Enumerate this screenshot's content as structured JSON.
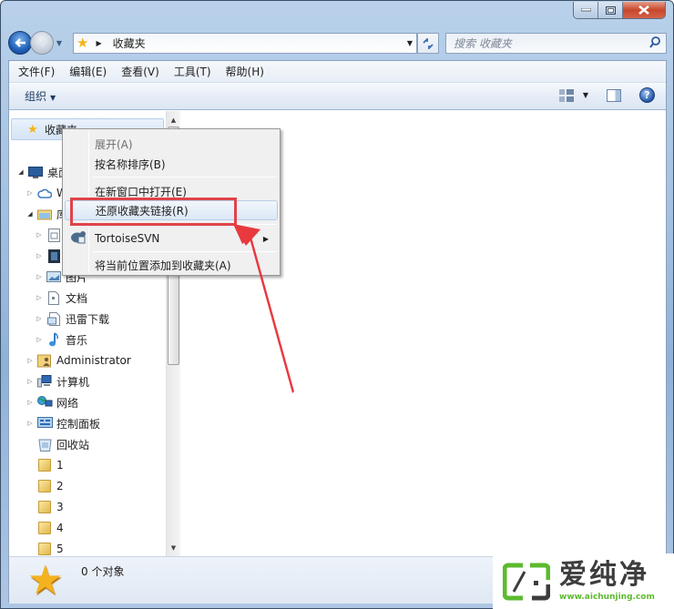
{
  "window": {
    "caption_buttons": {
      "minimize": "minimize",
      "maximize": "maximize",
      "close": "close"
    }
  },
  "address_bar": {
    "path": "收藏夹",
    "refresh_icon": "refresh-icon"
  },
  "search": {
    "placeholder": "搜索 收藏夹"
  },
  "menubar": {
    "items": [
      {
        "label": "文件(F)"
      },
      {
        "label": "编辑(E)"
      },
      {
        "label": "查看(V)"
      },
      {
        "label": "工具(T)"
      },
      {
        "label": "帮助(H)"
      }
    ]
  },
  "toolbar": {
    "organize_label": "组织",
    "help_glyph": "?"
  },
  "nav_pane": {
    "favorites_label": "收藏夹",
    "items": [
      {
        "label": "桌面",
        "icon": "desktop-icon"
      },
      {
        "label": "W",
        "icon": "cloud-icon"
      },
      {
        "label": "库",
        "icon": "library-icon"
      },
      {
        "label": "",
        "icon": "document-library-icon"
      },
      {
        "label": "",
        "icon": "video-library-icon"
      },
      {
        "label": "图片",
        "icon": "pictures-icon"
      },
      {
        "label": "文档",
        "icon": "documents-icon"
      },
      {
        "label": "迅雷下载",
        "icon": "download-icon"
      },
      {
        "label": "音乐",
        "icon": "music-icon"
      },
      {
        "label": "Administrator",
        "icon": "user-folder-icon"
      },
      {
        "label": "计算机",
        "icon": "computer-icon"
      },
      {
        "label": "网络",
        "icon": "network-icon"
      },
      {
        "label": "控制面板",
        "icon": "control-panel-icon"
      },
      {
        "label": "回收站",
        "icon": "recycle-bin-icon"
      },
      {
        "label": "1",
        "icon": "folder-icon"
      },
      {
        "label": "2",
        "icon": "folder-icon"
      },
      {
        "label": "3",
        "icon": "folder-icon"
      },
      {
        "label": "4",
        "icon": "folder-icon"
      },
      {
        "label": "5",
        "icon": "folder-icon"
      }
    ]
  },
  "context_menu": {
    "items": [
      {
        "label": "展开(A)",
        "disabled": true
      },
      {
        "label": "按名称排序(B)"
      },
      {
        "label": "在新窗口中打开(E)"
      },
      {
        "label": "还原收藏夹链接(R)",
        "highlighted": true
      },
      {
        "label": "TortoiseSVN",
        "submenu": true
      },
      {
        "label": "将当前位置添加到收藏夹(A)"
      }
    ]
  },
  "status_bar": {
    "text": "0 个对象"
  },
  "watermark": {
    "title": "爱纯净",
    "url": "www.aichunjing.com"
  },
  "annotation": {
    "highlight_color": "#e0434a",
    "arrow_color": "#e8393f"
  }
}
